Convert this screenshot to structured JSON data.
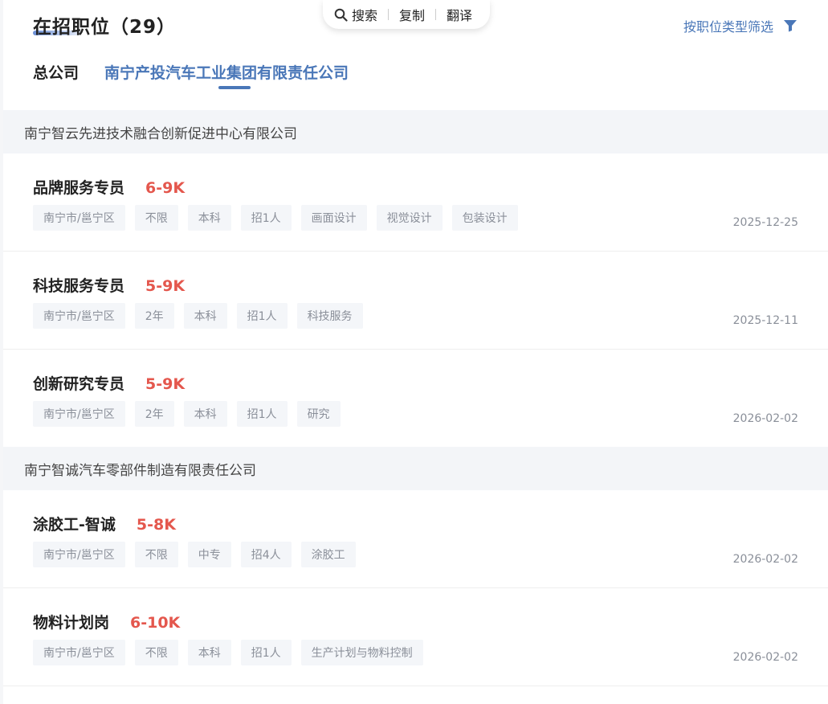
{
  "header": {
    "title": "在招职位",
    "count": "（29）",
    "filter_label": "按职位类型筛选",
    "tabs": [
      "总公司",
      "南宁产投汽车工业集团有限责任公司"
    ]
  },
  "context_popup": {
    "search": "搜索",
    "copy": "复制",
    "translate": "翻译"
  },
  "sections": [
    {
      "name": "南宁智云先进技术融合创新促进中心有限公司",
      "jobs": [
        {
          "title": "品牌服务专员",
          "salary": "6-9K",
          "tags": [
            "南宁市/邕宁区",
            "不限",
            "本科",
            "招1人",
            "画面设计",
            "视觉设计",
            "包装设计"
          ],
          "date": "2025-12-25"
        },
        {
          "title": "科技服务专员",
          "salary": "5-9K",
          "tags": [
            "南宁市/邕宁区",
            "2年",
            "本科",
            "招1人",
            "科技服务"
          ],
          "date": "2025-12-11"
        },
        {
          "title": "创新研究专员",
          "salary": "5-9K",
          "tags": [
            "南宁市/邕宁区",
            "2年",
            "本科",
            "招1人",
            "研究"
          ],
          "date": "2026-02-02"
        }
      ]
    },
    {
      "name": "南宁智诚汽车零部件制造有限责任公司",
      "jobs": [
        {
          "title": "涂胶工-智诚",
          "salary": "5-8K",
          "tags": [
            "南宁市/邕宁区",
            "不限",
            "中专",
            "招4人",
            "涂胶工"
          ],
          "date": "2026-02-02"
        },
        {
          "title": "物料计划岗",
          "salary": "6-10K",
          "tags": [
            "南宁市/邕宁区",
            "不限",
            "本科",
            "招1人",
            "生产计划与物料控制"
          ],
          "date": "2026-02-02"
        }
      ]
    }
  ],
  "colors": {
    "accent": "#4a77b8",
    "salary": "#e4574d",
    "tag_bg": "#f4f6f9",
    "section_bg": "#f3f5f8"
  }
}
